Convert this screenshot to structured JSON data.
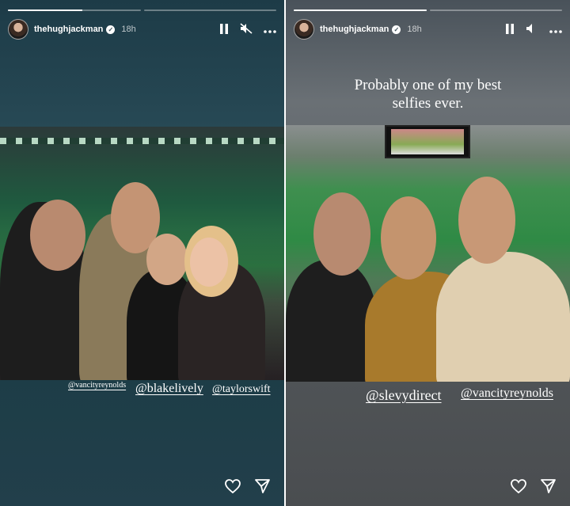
{
  "stories": [
    {
      "progress": [
        0.56,
        0
      ],
      "username": "thehughjackman",
      "time": "18h",
      "mute_icon": "muted-speaker-icon",
      "tags": [
        "@vancityreynolds",
        "@blakelively",
        "@taylorswift"
      ]
    },
    {
      "progress": [
        1,
        0
      ],
      "username": "thehughjackman",
      "time": "18h",
      "mute_icon": "speaker-icon",
      "caption": [
        "Probably one of my best",
        "selfies ever."
      ],
      "tags": [
        "@slevydirect",
        "@vancityreynolds"
      ]
    }
  ],
  "colors": {
    "text": "#ffffff",
    "story1_bg": "#274955",
    "story2_bg": "#5a5f63"
  }
}
